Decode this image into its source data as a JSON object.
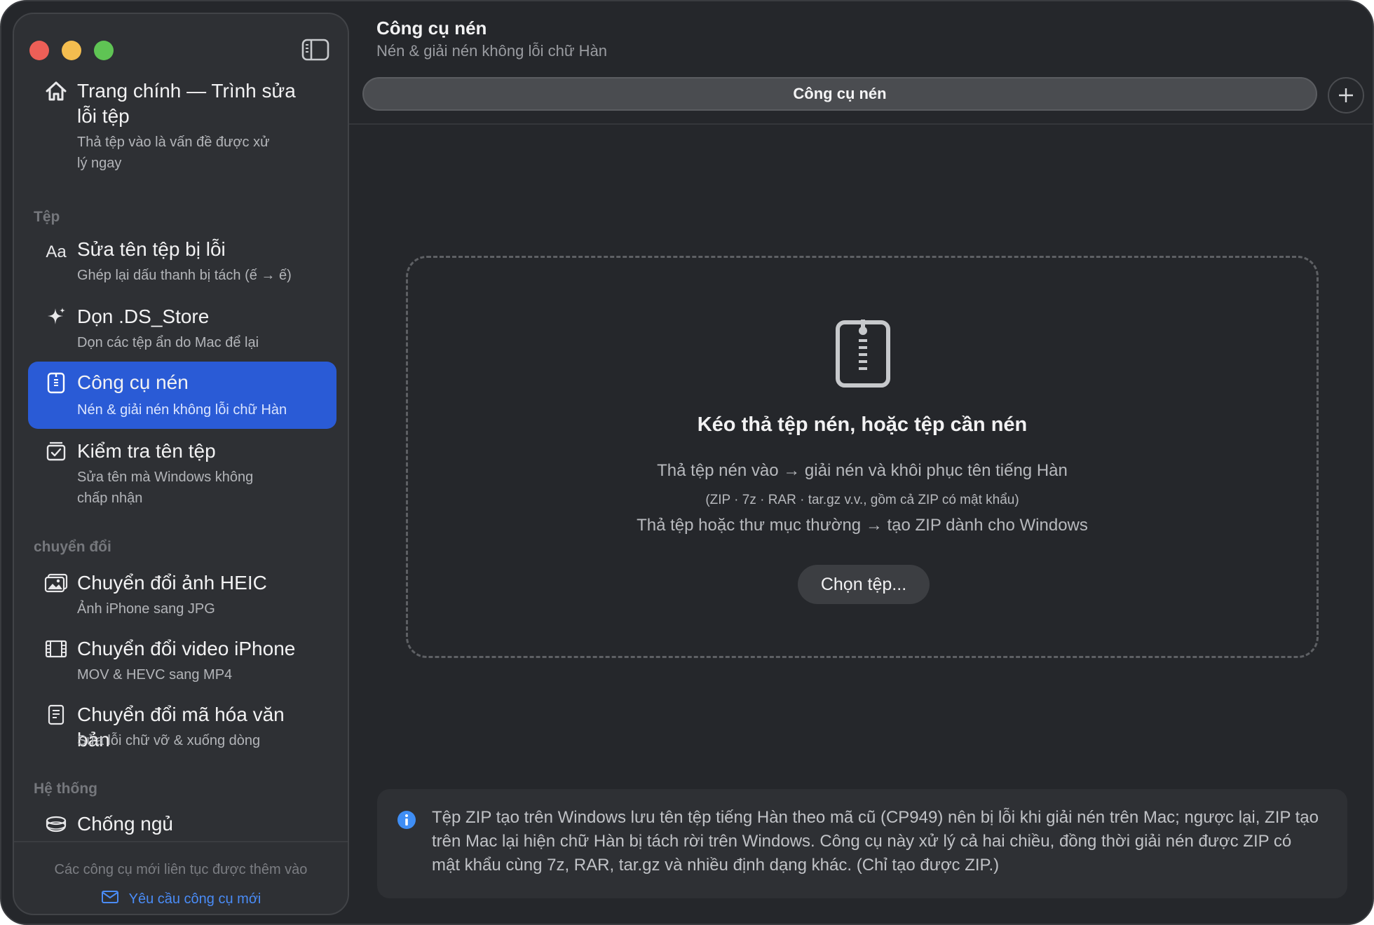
{
  "window": {
    "traffic_lights": {
      "close": "#ed5f57",
      "minimize": "#f4bd4f",
      "zoom": "#5fc454"
    },
    "sidebar_toggle_icon": "sidebar-toggle-icon"
  },
  "sidebar": {
    "home": {
      "title_line1": "Trang chính — Trình sửa",
      "title_line2": "lỗi tệp",
      "sub_line1": "Thả tệp vào là vấn đề được xử",
      "sub_line2": "lý ngay",
      "icon": "house-icon"
    },
    "sections": {
      "files": "Tệp",
      "convert": "chuyển đổi",
      "system": "Hệ thống"
    },
    "items": [
      {
        "title": "Sửa tên tệp bị lỗi",
        "sub": "Ghép lại dấu thanh bị tách (ế → ế)",
        "icon": "text-aa-icon"
      },
      {
        "title": "Dọn .DS_Store",
        "sub": "Dọn các tệp ẩn do Mac để lại",
        "icon": "sparkle-icon"
      },
      {
        "title": "Công cụ nén",
        "sub": "Nén & giải nén không lỗi chữ Hàn",
        "icon": "zip-file-icon",
        "active": true
      },
      {
        "title": "Kiểm tra tên tệp",
        "sub_line1": "Sửa tên mà Windows không",
        "sub_line2": "chấp nhận",
        "icon": "checkbox-icon"
      },
      {
        "title": "Chuyển đổi ảnh HEIC",
        "sub": "Ảnh iPhone sang JPG",
        "icon": "photos-icon"
      },
      {
        "title": "Chuyển đổi video iPhone",
        "sub": "MOV & HEVC sang MP4",
        "icon": "film-icon"
      },
      {
        "title": "Chuyển đổi mã hóa văn bản",
        "sub": "Sửa lỗi chữ vỡ & xuống dòng",
        "icon": "document-icon"
      },
      {
        "title": "Chống ngủ",
        "icon": "coffee-cup-icon"
      }
    ],
    "footer": {
      "note": "Các công cụ mới liên tục được thêm vào",
      "link": "Yêu cầu công cụ mới",
      "link_icon": "envelope-icon"
    }
  },
  "main": {
    "title": "Công cụ nén",
    "subtitle": "Nén & giải nén không lỗi chữ Hàn",
    "tab_label": "Công cụ nén",
    "add_tab_icon": "plus-icon",
    "dropzone": {
      "icon": "zip-file-icon",
      "title": "Kéo thả tệp nén, hoặc tệp cần nén",
      "line1": "Thả tệp nén vào → giải nén và khôi phục tên tiếng Hàn",
      "line2": "(ZIP · 7z · RAR · tar.gz v.v., gồm cả ZIP có mật khẩu)",
      "line3": "Thả tệp hoặc thư mục thường → tạo ZIP dành cho Windows",
      "button": "Chọn tệp..."
    },
    "info": {
      "icon": "info-icon",
      "text": "Tệp ZIP tạo trên Windows lưu tên tệp tiếng Hàn theo mã cũ (CP949) nên bị lỗi khi giải nén trên Mac; ngược lại, ZIP tạo trên Mac lại hiện chữ Hàn bị tách rời trên Windows. Công cụ này xử lý cả hai chiều, đồng thời giải nén được ZIP có mật khẩu cùng 7z, RAR, tar.gz và nhiều định dạng khác. (Chỉ tạo được ZIP.)"
    }
  },
  "colors": {
    "accent": "#2a5bd6",
    "link": "#4a8cf7",
    "info": "#3f8ef5"
  }
}
